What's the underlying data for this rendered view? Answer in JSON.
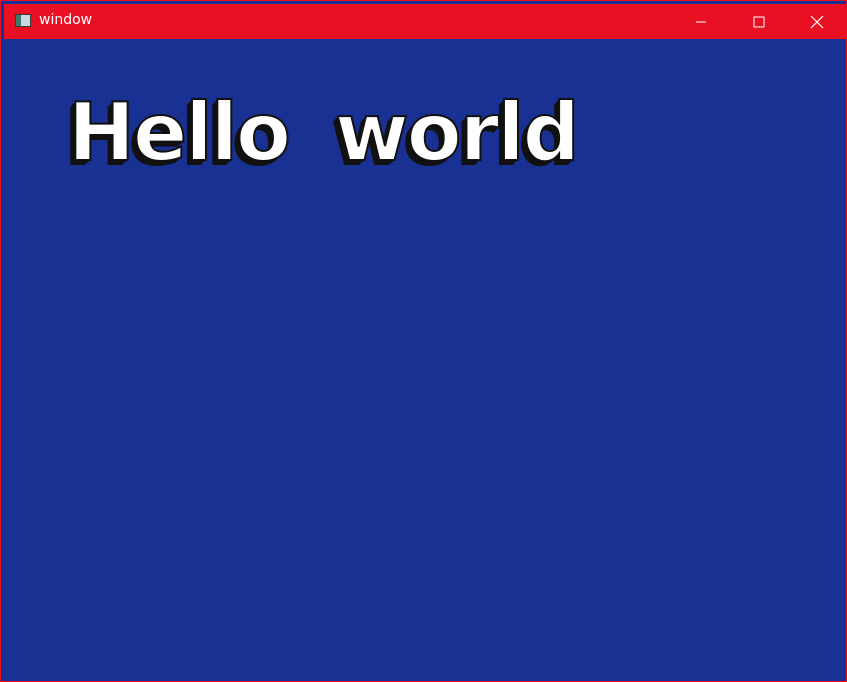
{
  "window": {
    "title": "window",
    "icon": "app-window-icon",
    "controls": {
      "minimize_icon": "minimize-icon",
      "maximize_icon": "maximize-icon",
      "close_icon": "close-icon"
    }
  },
  "content": {
    "text": "Hello world"
  },
  "colors": {
    "titlebar": "#ea1023",
    "background": "#1a3194",
    "text": "#ffffff",
    "text_shadow": "#111111"
  }
}
